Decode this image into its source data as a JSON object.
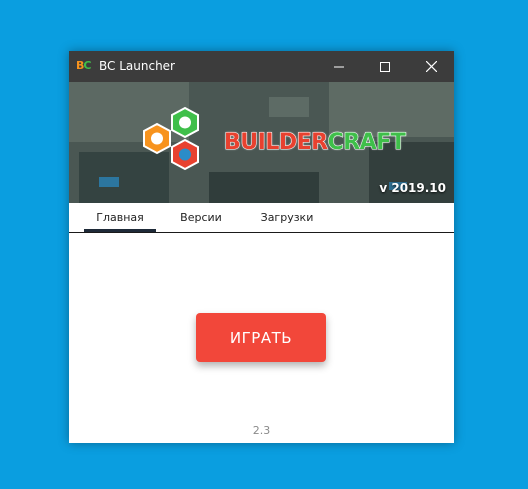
{
  "window": {
    "title": "BC Launcher",
    "app_icon_text": {
      "b": "B",
      "c": "C"
    },
    "controls": {
      "minimize": "minimize-icon",
      "maximize": "maximize-icon",
      "close": "close-icon"
    }
  },
  "banner": {
    "logo_text_part1": "BUILDER",
    "logo_text_part2": "CRAFT",
    "version": "v 2019.10",
    "colors": {
      "orange": "#f7931e",
      "green": "#3fbf4a",
      "red": "#e8412f"
    }
  },
  "tabs": [
    {
      "label": "Главная",
      "active": true
    },
    {
      "label": "Версии",
      "active": false
    },
    {
      "label": "Загрузки",
      "active": false
    }
  ],
  "main": {
    "play_label": "ИГРАТЬ",
    "build_number": "2.3"
  },
  "colors": {
    "desktop": "#0a9ee0",
    "titlebar": "#3c3c3c",
    "play_button": "#f2473a"
  }
}
